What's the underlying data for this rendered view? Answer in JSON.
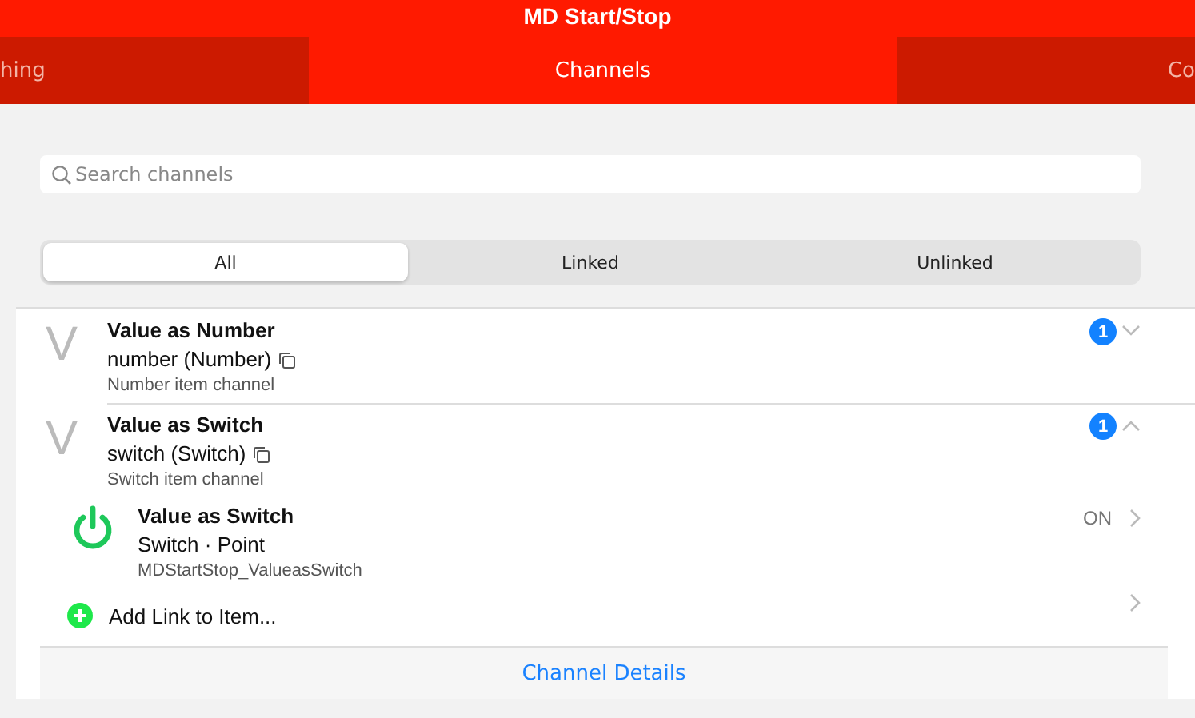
{
  "window": {
    "title": "MD Start/Stop"
  },
  "tabs": [
    {
      "label": "hing",
      "selected": false
    },
    {
      "label": "Channels",
      "selected": true
    },
    {
      "label": "Co",
      "selected": false
    }
  ],
  "search": {
    "placeholder": "Search channels"
  },
  "filter": [
    {
      "label": "All",
      "selected": true
    },
    {
      "label": "Linked",
      "selected": false
    },
    {
      "label": "Unlinked",
      "selected": false
    }
  ],
  "channels": [
    {
      "letter": "V",
      "label": "Value as Number",
      "type": "number (Number)",
      "description": "Number item channel",
      "count": "1",
      "expanded": false
    },
    {
      "letter": "V",
      "label": "Value as Switch",
      "type": "switch (Switch)",
      "description": "Switch item channel",
      "count": "1",
      "expanded": true,
      "links": [
        {
          "label": "Value as Switch",
          "type": "Switch · Point",
          "name": "MDStartStop_ValueasSwitch",
          "state": "ON",
          "on": true
        }
      ],
      "add_link": "Add Link to Item...",
      "details": "Channel Details"
    }
  ]
}
